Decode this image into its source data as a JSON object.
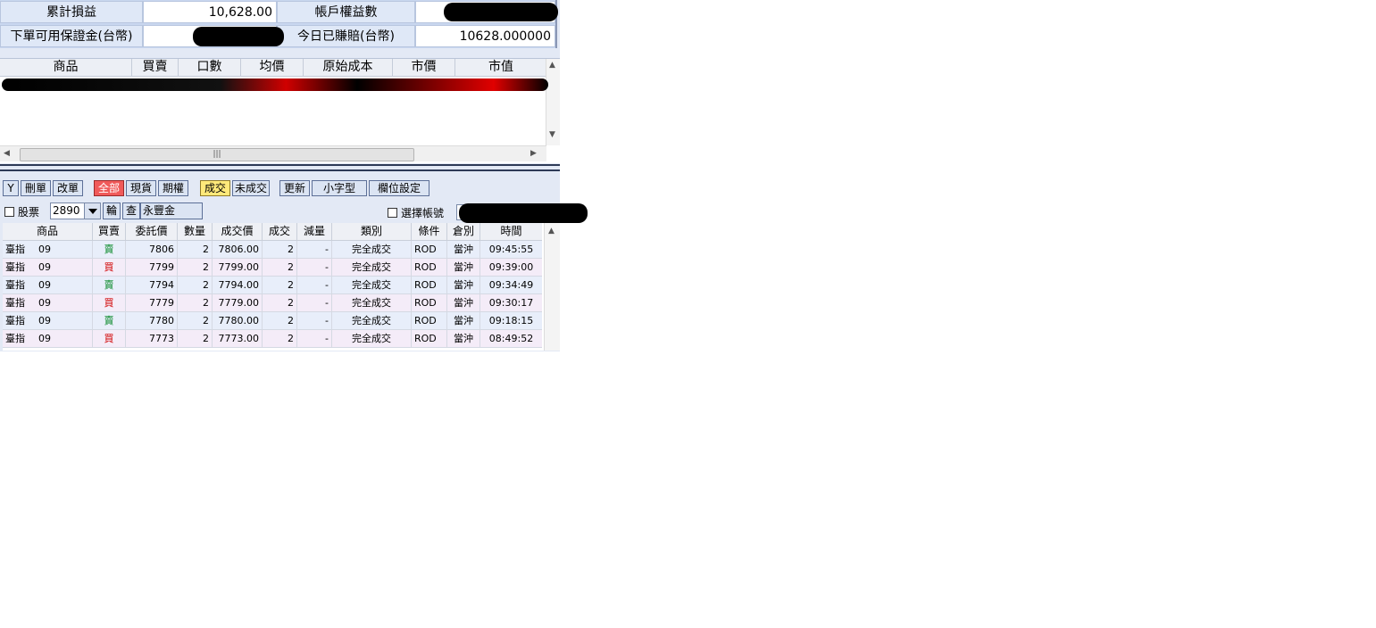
{
  "summary": {
    "cum_pnl_label": "累計損益",
    "cum_pnl_value": "10,628.00",
    "equity_label": "帳戶權益數",
    "margin_label": "下單可用保證金(台幣)",
    "today_pnl_label": "今日已賺賠(台幣)",
    "today_pnl_value": "10628.000000"
  },
  "positions": {
    "headers": [
      "商品",
      "買賣",
      "口數",
      "均價",
      "原始成本",
      "市價",
      "市值"
    ]
  },
  "toolbar": {
    "y": "Y",
    "delete": "刪單",
    "modify": "改單",
    "all": "全部",
    "spot": "現貨",
    "futures": "期權",
    "filled": "成交",
    "unfilled": "未成交",
    "refresh": "更新",
    "small": "小字型",
    "columns": "欄位設定"
  },
  "filter": {
    "stock_label": "股票",
    "symbol": "2890",
    "rotate": "輪",
    "query": "查",
    "symbol_name": "永豐金",
    "select_account": "選擇帳號"
  },
  "orders": {
    "headers": [
      "商品",
      "買賣",
      "委託價",
      "數量",
      "成交價",
      "成交",
      "減量",
      "類別",
      "條件",
      "倉別",
      "時間"
    ],
    "rows": [
      {
        "product": "臺指",
        "month": "09",
        "side": "賣",
        "price": "7806",
        "qty": "2",
        "fill_price": "7806.00",
        "filled": "2",
        "reduced": "-",
        "type": "完全成交",
        "cond": "ROD",
        "pos": "當沖",
        "time": "09:45:55"
      },
      {
        "product": "臺指",
        "month": "09",
        "side": "買",
        "price": "7799",
        "qty": "2",
        "fill_price": "7799.00",
        "filled": "2",
        "reduced": "-",
        "type": "完全成交",
        "cond": "ROD",
        "pos": "當沖",
        "time": "09:39:00"
      },
      {
        "product": "臺指",
        "month": "09",
        "side": "賣",
        "price": "7794",
        "qty": "2",
        "fill_price": "7794.00",
        "filled": "2",
        "reduced": "-",
        "type": "完全成交",
        "cond": "ROD",
        "pos": "當沖",
        "time": "09:34:49"
      },
      {
        "product": "臺指",
        "month": "09",
        "side": "買",
        "price": "7779",
        "qty": "2",
        "fill_price": "7779.00",
        "filled": "2",
        "reduced": "-",
        "type": "完全成交",
        "cond": "ROD",
        "pos": "當沖",
        "time": "09:30:17"
      },
      {
        "product": "臺指",
        "month": "09",
        "side": "賣",
        "price": "7780",
        "qty": "2",
        "fill_price": "7780.00",
        "filled": "2",
        "reduced": "-",
        "type": "完全成交",
        "cond": "ROD",
        "pos": "當沖",
        "time": "09:18:15"
      },
      {
        "product": "臺指",
        "month": "09",
        "side": "買",
        "price": "7773",
        "qty": "2",
        "fill_price": "7773.00",
        "filled": "2",
        "reduced": "-",
        "type": "完全成交",
        "cond": "ROD",
        "pos": "當沖",
        "time": "08:49:52"
      }
    ]
  },
  "colors": {
    "sell": "#0a8a2a",
    "buy": "#d00000",
    "active_all": "#f05a5a",
    "active_filled": "#ffe97a"
  }
}
